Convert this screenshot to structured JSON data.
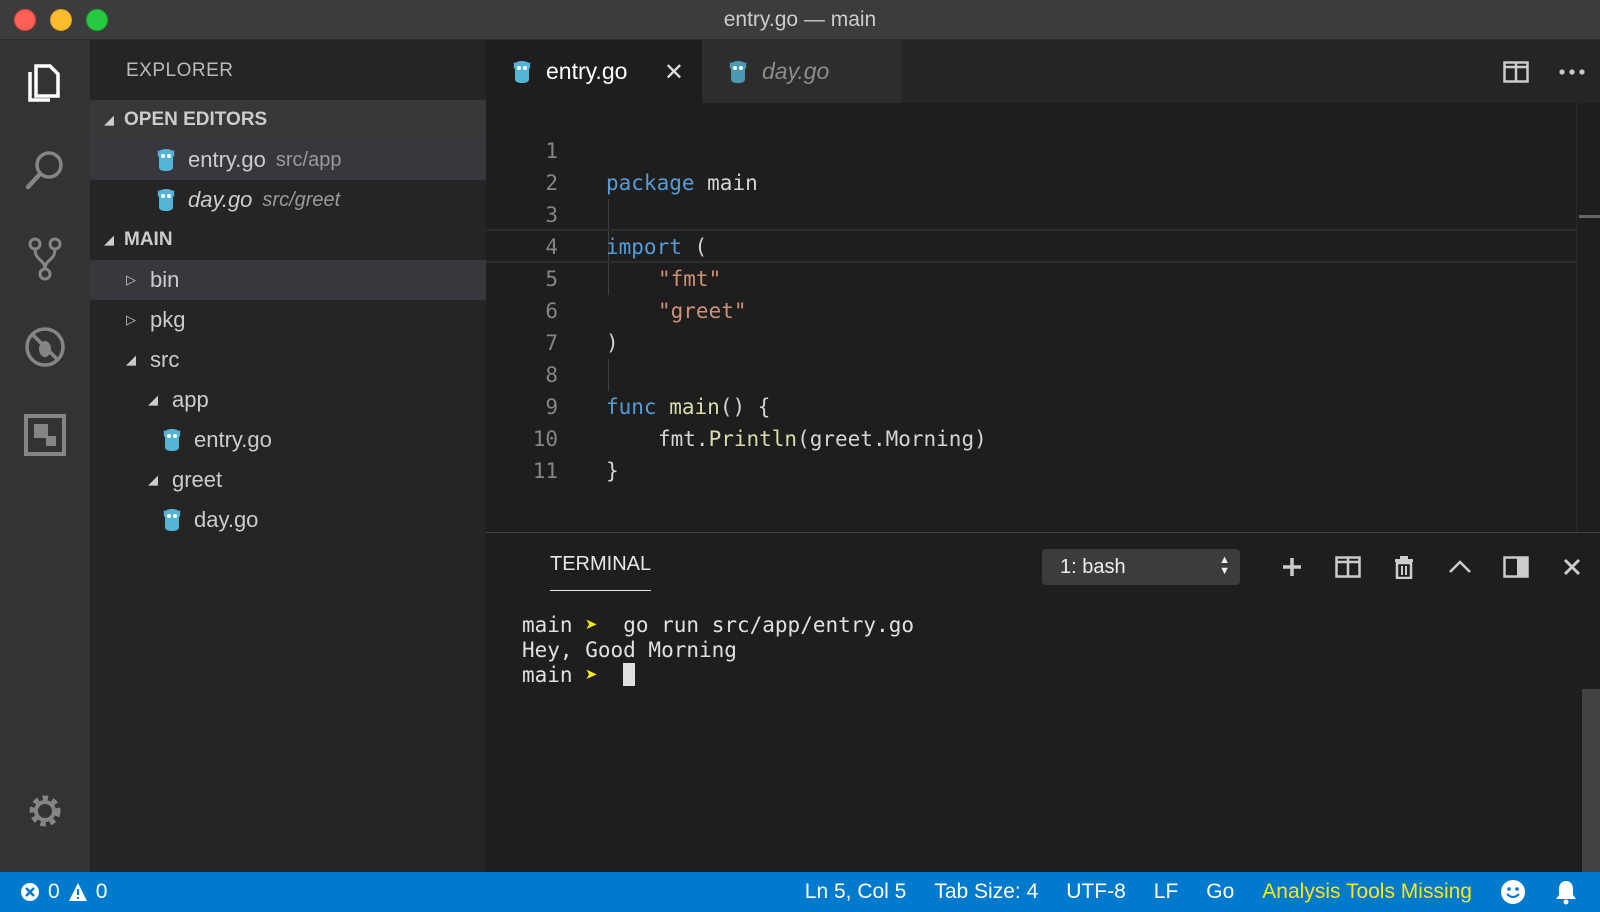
{
  "window": {
    "title": "entry.go — main"
  },
  "sidebar": {
    "title": "EXPLORER",
    "open_editors": {
      "label": "OPEN EDITORS",
      "items": [
        {
          "name": "entry.go",
          "path": "src/app"
        },
        {
          "name": "day.go",
          "path": "src/greet"
        }
      ]
    },
    "main": {
      "label": "MAIN",
      "tree": [
        {
          "label": "bin"
        },
        {
          "label": "pkg"
        },
        {
          "label": "src"
        },
        {
          "label": "app"
        },
        {
          "label": "entry.go"
        },
        {
          "label": "greet"
        },
        {
          "label": "day.go"
        }
      ]
    }
  },
  "tabs": [
    {
      "label": "entry.go",
      "close": "✕"
    },
    {
      "label": "day.go"
    }
  ],
  "editor": {
    "line_numbers": [
      "1",
      "2",
      "3",
      "4",
      "5",
      "6",
      "7",
      "8",
      "9",
      "10",
      "11"
    ],
    "code": {
      "l1_kw": "package",
      "l1_rest": " main",
      "l3_kw": "import",
      "l3_rest": " (",
      "l4_str": "\"fmt\"",
      "l5_str": "\"greet\"",
      "l6": ")",
      "l8_kw": "func",
      "l8_fn": "main",
      "l8_rest": "() {",
      "l9_a": "fmt.",
      "l9_fn": "Println",
      "l9_b": "(greet.Morning)",
      "l10": "}"
    }
  },
  "panel": {
    "tab": "TERMINAL",
    "terminal_select": "1: bash",
    "lines": [
      {
        "prompt": "main",
        "arrow": "➤",
        "cmd": "go run src/app/entry.go"
      },
      {
        "output": "Hey, Good Morning"
      },
      {
        "prompt": "main",
        "arrow": "➤",
        "cmd": ""
      }
    ]
  },
  "status": {
    "errors": "0",
    "warnings": "0",
    "position": "Ln 5, Col 5",
    "tab_size": "Tab Size: 4",
    "encoding": "UTF-8",
    "eol": "LF",
    "language": "Go",
    "analysis": "Analysis Tools Missing"
  },
  "colors": {
    "status_bar": "#007acc",
    "keyword": "#569cd6",
    "string": "#ce9178",
    "function": "#dcdcaa",
    "warning_text": "#f8e71c",
    "gopher": "#54b4d6"
  },
  "icons": [
    "explorer-icon",
    "search-icon",
    "source-control-icon",
    "debug-icon",
    "extensions-icon",
    "gear-icon",
    "gopher-icon",
    "split-editor-icon",
    "more-icon",
    "plus-icon",
    "split-terminal-icon",
    "trash-icon",
    "chevron-up-icon",
    "panel-toggle-icon",
    "close-icon",
    "error-icon",
    "warning-icon",
    "smiley-icon",
    "bell-icon"
  ]
}
